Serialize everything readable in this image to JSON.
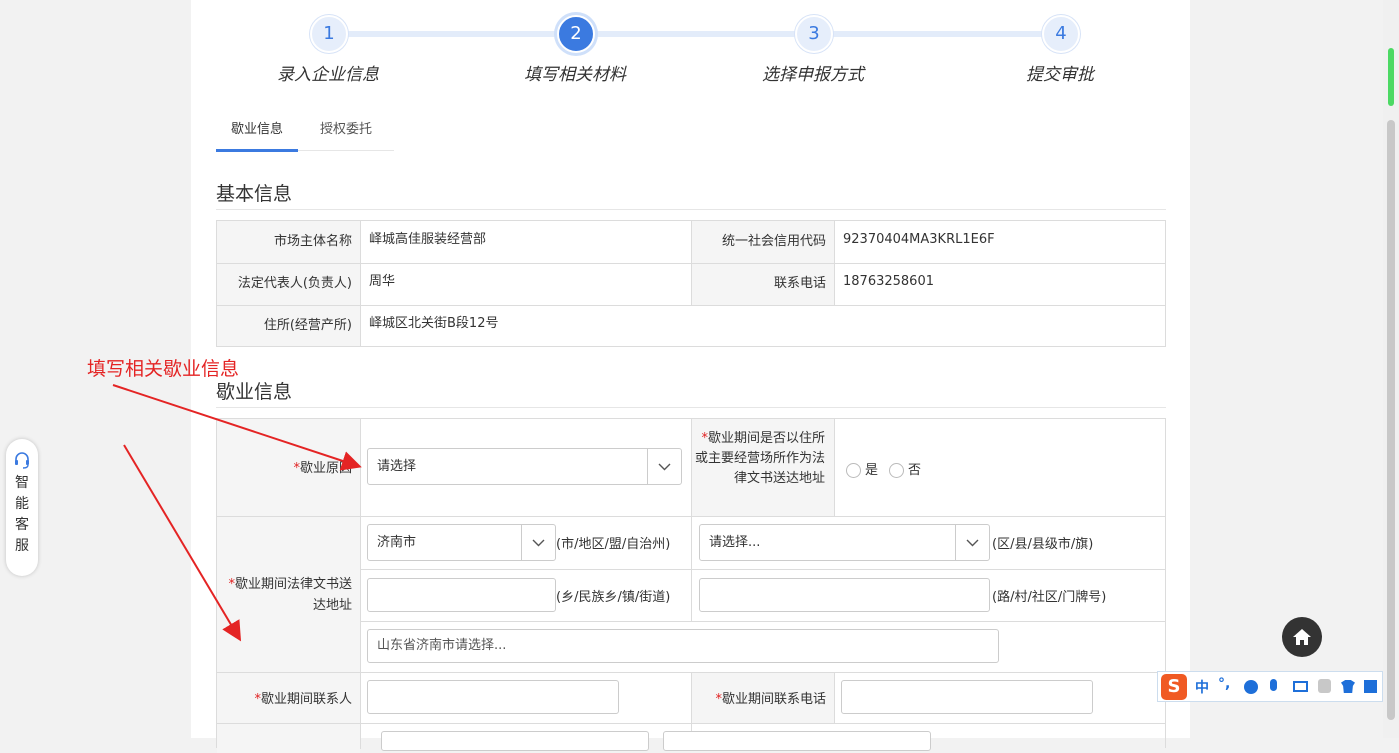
{
  "steps": [
    {
      "num": "1",
      "label": "录入企业信息"
    },
    {
      "num": "2",
      "label": "填写相关材料"
    },
    {
      "num": "3",
      "label": "选择申报方式"
    },
    {
      "num": "4",
      "label": "提交审批"
    }
  ],
  "tabs": [
    "歇业信息",
    "授权委托"
  ],
  "basic": {
    "title": "基本信息",
    "name_label": "市场主体名称",
    "name_value": "峄城高佳服装经营部",
    "code_label": "统一社会信用代码",
    "code_value": "92370404MA3KRL1E6F",
    "rep_label": "法定代表人(负责人)",
    "rep_value": "周华",
    "phone_label": "联系电话",
    "phone_value": "18763258601",
    "addr_label": "住所(经营产所)",
    "addr_value": "峄城区北关街B段12号"
  },
  "closure": {
    "title": "歇业信息",
    "reason_label": "歇业原因",
    "reason_placeholder": "请选择",
    "addr_question": "歇业期间是否以住所或主要经营场所作为法律文书送达地址",
    "yes": "是",
    "no": "否",
    "legal_addr_label": "歇业期间法律文书送达地址",
    "city_value": "济南市",
    "city_hint": "(市/地区/盟/自治州)",
    "district_value": "请选择...",
    "district_hint": "(区/县/县级市/旗)",
    "town_hint": "(乡/民族乡/镇/街道)",
    "road_hint": "(路/村/社区/门牌号)",
    "full_addr": "山东省济南市请选择...",
    "contact_label": "歇业期间联系人",
    "contact_phone_label": "歇业期间联系电话"
  },
  "annotation": "填写相关歇业信息",
  "customer_service": "智能客服",
  "ime": {
    "lang": "中",
    "punct": "°,"
  }
}
